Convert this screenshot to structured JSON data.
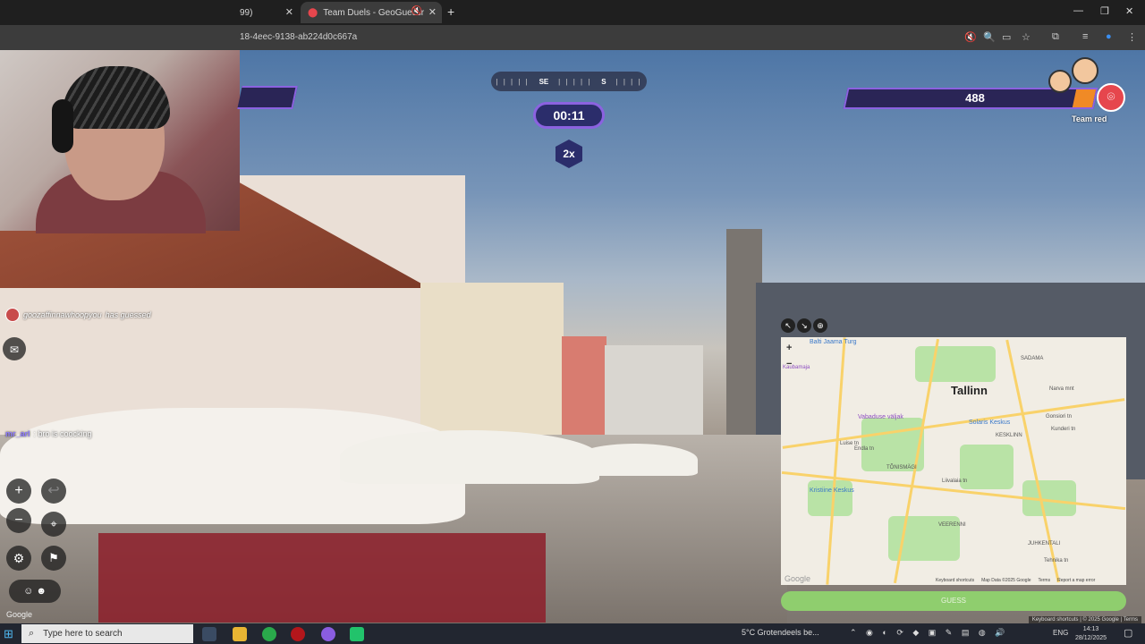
{
  "browser": {
    "tabs": [
      {
        "label": "99)"
      },
      {
        "label": "Team Duels - GeoGuessr"
      }
    ],
    "url": "18-4eec-9138-ab224d0c667a"
  },
  "game": {
    "compass": {
      "left": "SE",
      "right": "S"
    },
    "timer": "00:11",
    "multiplier": "2x",
    "team_score": "488",
    "team_name": "Team red",
    "score_fraction": 0.08,
    "chat": [
      {
        "user": "goozaffinnawhoopyou",
        "text": "has guessed"
      },
      {
        "user": "mr_arl",
        "text": ": bro is coocking"
      }
    ],
    "street_view_credit": "Google",
    "guess_label": "GUESS",
    "footer": "Keyboard shortcuts  |  © 2025 Google  |  Terms"
  },
  "minimap": {
    "city": "Tallinn",
    "labels": [
      "Balti Jaama Turg",
      "Kaubamaja",
      "Vabaduse väljak",
      "Solaris Keskus",
      "TÕNISMÄGI",
      "Kristiine Keskus",
      "KESKLINN",
      "SADAMA",
      "VEERENNI",
      "JUHKENTALI",
      "Endla tn",
      "Luise tn",
      "Narva mnt",
      "Gonsiori tn",
      "Kunderi tn",
      "Liivalaia tn",
      "Tehnika tn"
    ],
    "footer": [
      "Keyboard shortcuts",
      "Map Data ©2025 Google",
      "Terms",
      "Report a map error"
    ],
    "logo": "Google"
  },
  "taskbar": {
    "search_placeholder": "Type here to search",
    "weather": "5°C  Grotendeels be...",
    "lang": "ENG",
    "time": "14:13",
    "date": "28/12/2025"
  }
}
